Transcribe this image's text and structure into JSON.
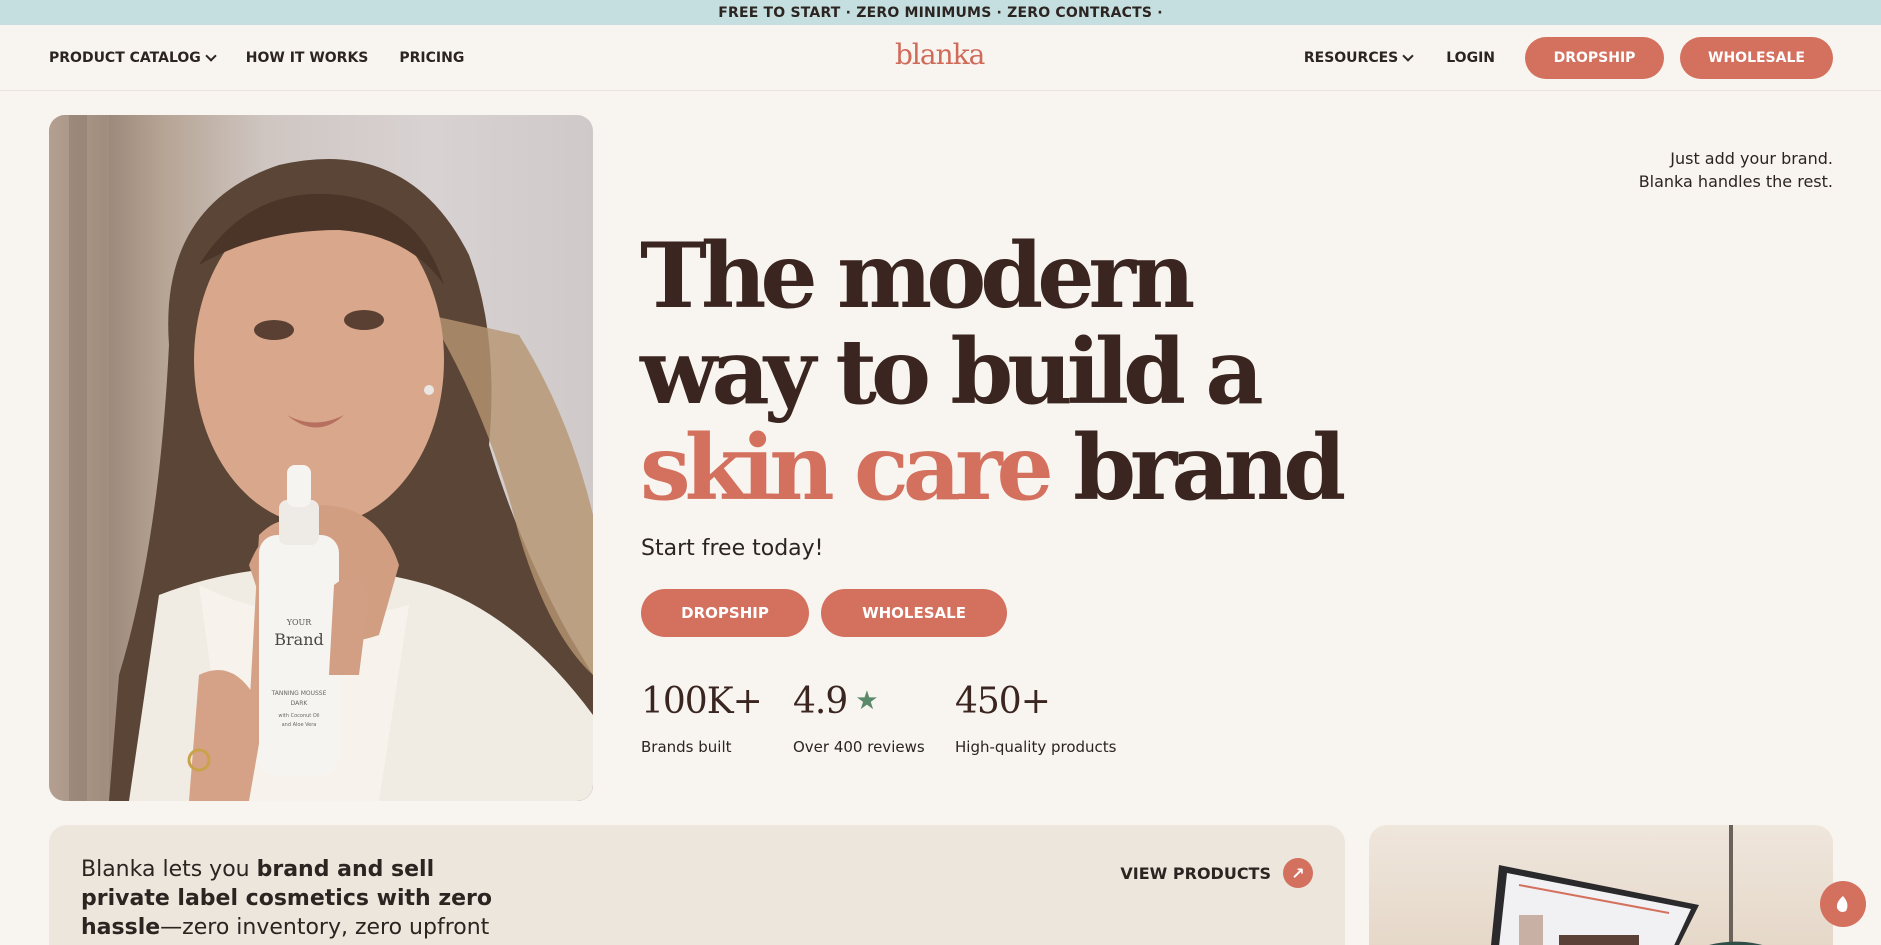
{
  "announcement": "FREE TO START · ZERO MINIMUMS · ZERO CONTRACTS ·",
  "nav": {
    "left": [
      {
        "label": "PRODUCT CATALOG"
      },
      {
        "label": "HOW IT WORKS"
      },
      {
        "label": "PRICING"
      }
    ],
    "logo": "blanka",
    "resources": "RESOURCES",
    "login": "LOGIN",
    "dropship": "DROPSHIP",
    "wholesale": "WHOLESALE"
  },
  "hero": {
    "image_alt": "Woman holding a white bottle labeled YOUR Brand tanning mousse",
    "bottle": {
      "brand_top": "YOUR",
      "brand_main": "Brand",
      "line1": "TANNING MOUSSE",
      "line2": "DARK",
      "line3": "with Coconut Oil",
      "line4": "and Aloe Vera"
    },
    "tagline_line1": "Just add your brand.",
    "tagline_line2": "Blanka handles the rest.",
    "headline_line1": "The modern",
    "headline_line2": "way to build a",
    "headline_accent": "skin care",
    "headline_end": "brand",
    "subhead": "Start free today!",
    "dropship": "DROPSHIP",
    "wholesale": "WHOLESALE",
    "stats": [
      {
        "value": "100K+",
        "label": "Brands built"
      },
      {
        "value": "4.9",
        "label": "Over 400 reviews"
      },
      {
        "value": "450+",
        "label": "High-quality products"
      }
    ]
  },
  "info": {
    "text_start": "Blanka lets you ",
    "text_bold": "brand and sell private label cosmetics with zero hassle",
    "text_end": "—zero inventory, zero upfront costs, and we",
    "view_products": "VIEW PRODUCTS"
  },
  "colors": {
    "accent": "#d4705e",
    "dark": "#3a2520",
    "topbar": "#c5dfe0",
    "star": "#5b8a6a",
    "background": "#f8f4ef"
  }
}
